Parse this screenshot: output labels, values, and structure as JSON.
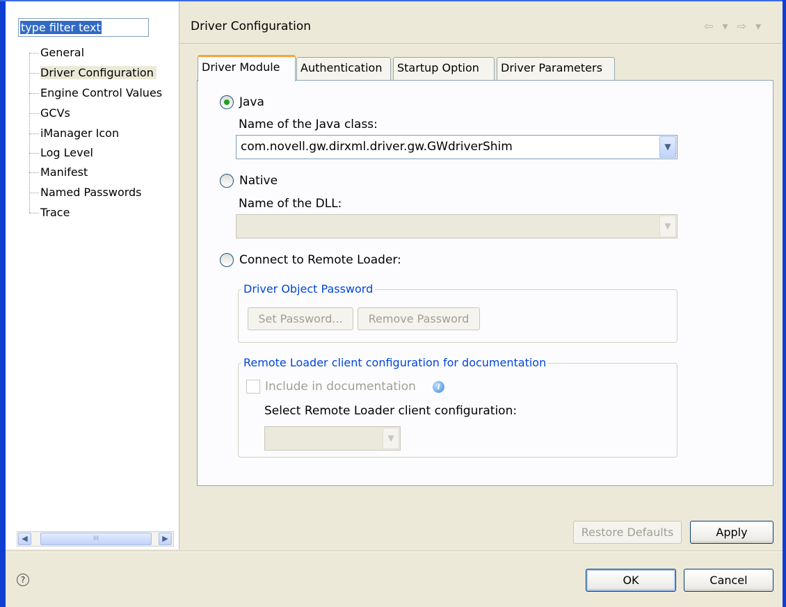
{
  "left": {
    "filter_text": "type filter text",
    "tree": [
      "General",
      "Driver Configuration",
      "Engine Control Values",
      "GCVs",
      "iManager Icon",
      "Log Level",
      "Manifest",
      "Named Passwords",
      "Trace"
    ],
    "scroll_thumb_grip": "III"
  },
  "header": {
    "title": "Driver Configuration",
    "nav_arrows": "⇦ ▾ ⇨ ▾"
  },
  "tabs": [
    "Driver Module",
    "Authentication",
    "Startup Option",
    "Driver Parameters"
  ],
  "module": {
    "java_label": "Java",
    "java_class_label": "Name of the Java class:",
    "java_class_value": "com.novell.gw.dirxml.driver.gw.GWdriverShim",
    "native_label": "Native",
    "dll_label": "Name of the DLL:",
    "dll_value": "",
    "remote_label": "Connect to Remote Loader:",
    "password_group": "Driver Object Password",
    "set_password": "Set Password...",
    "remove_password": "Remove Password",
    "rl_group": "Remote Loader client configuration for documentation",
    "include_doc": "Include in documentation",
    "select_rl": "Select Remote Loader client configuration:",
    "rl_value": ""
  },
  "buttons": {
    "restore": "Restore Defaults",
    "apply": "Apply",
    "ok": "OK",
    "cancel": "Cancel",
    "help": "?"
  },
  "colors": {
    "accent": "#0f3fd0",
    "tab_highlight": "#f7a33b",
    "group_title": "#0046d5",
    "radio_dot": "#21a121"
  }
}
